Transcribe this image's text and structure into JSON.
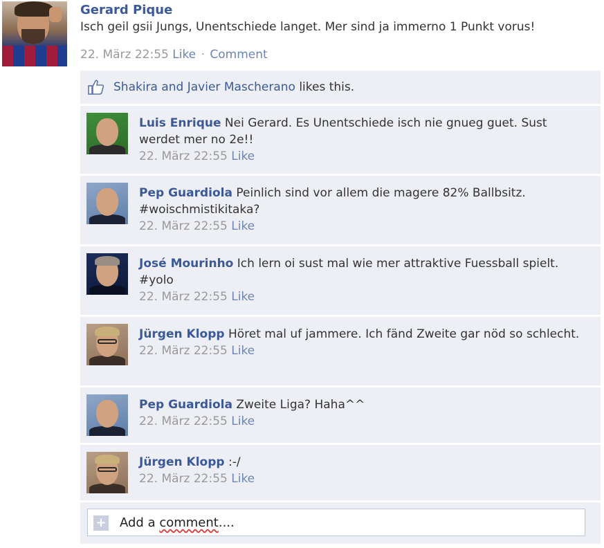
{
  "post": {
    "author": "Gerard Pique",
    "text": "Isch geil gsii Jungs, Unentschiede langet. Mer sind ja immerno 1 Punkt vorus!",
    "time": "22. März 22:55",
    "like_label": "Like",
    "separator": "·",
    "comment_label": "Comment"
  },
  "likes": {
    "names": "Shakira and Javier Mascherano",
    "suffix": " likes this.",
    "icon": "thumbs-up-icon"
  },
  "comments": [
    {
      "author": "Luis Enrique",
      "text": " Nei Gerard. Es Unentschiede isch nie gnueg guet. Sust werdet mer no 2e!!",
      "time": "22. März 22:55",
      "like": "Like"
    },
    {
      "author": "Pep Guardiola",
      "text": " Peinlich sind vor allem die magere 82% Ballbsitz. #woischmistikitaka?",
      "time": "22. März 22:55",
      "like": "Like"
    },
    {
      "author": "José Mourinho",
      "text": " Ich lern oi sust mal wie mer attraktive Fuessball spielt. #yolo",
      "time": "22. März 22:55",
      "like": "Like"
    },
    {
      "author": "Jürgen Klopp",
      "text": " Höret mal uf jammere. Ich fänd Zweite gar nöd so schlecht.",
      "time": "22. März 22:55",
      "like": "Like"
    },
    {
      "author": "Pep Guardiola",
      "text": " Zweite Liga? Haha^^",
      "time": "22. März 22:55",
      "like": "Like"
    },
    {
      "author": "Jürgen Klopp",
      "text": " :-/",
      "time": "22. März 22:55",
      "like": "Like"
    }
  ],
  "add_comment": {
    "placeholder_pre": "Add a ",
    "placeholder_word": "comment",
    "placeholder_post": "....",
    "icon": "plus-icon"
  }
}
